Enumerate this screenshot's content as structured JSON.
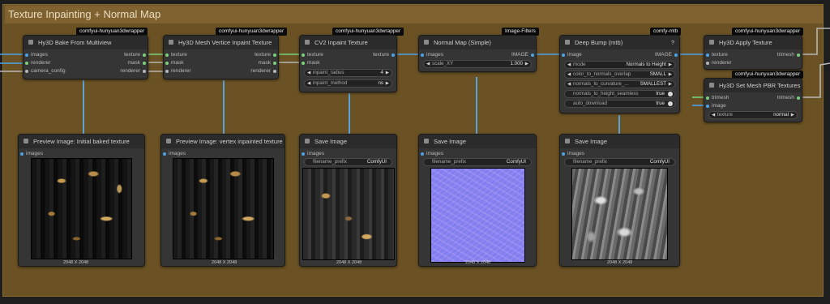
{
  "group": {
    "title": "Texture Inpainting + Normal Map"
  },
  "colors": {
    "group_bg": "#6b5224",
    "node_bg": "#353535",
    "wire_blue": "#5aa2d8",
    "slot_green": "#79d27a",
    "slot_blue": "#4da3e8",
    "slot_gray": "#b6b6b6"
  },
  "nodes": {
    "bake": {
      "badge": "comfyui-hunyuan3dwrapper",
      "title": "Hy3D Bake From Multiview",
      "inputs": [
        "images",
        "renderer",
        "camera_config"
      ],
      "outputs": [
        "texture",
        "mask",
        "renderer"
      ]
    },
    "inpaint": {
      "badge": "comfyui-hunyuan3dwrapper",
      "title": "Hy3D Mesh Vertice Inpaint Texture",
      "inputs": [
        "texture",
        "mask",
        "renderer"
      ],
      "outputs": [
        "texture",
        "mask",
        "renderer"
      ]
    },
    "cv2": {
      "badge": "comfyui-hunyuan3dwrapper",
      "title": "CV2 Inpaint Texture",
      "inputs": [
        "texture",
        "mask"
      ],
      "outputs": [
        "texture"
      ],
      "widgets": [
        {
          "label": "inpaint_radius",
          "value": "4"
        },
        {
          "label": "inpaint_method",
          "value": "ns"
        }
      ]
    },
    "normal": {
      "badge": "Image-Filters",
      "title": "Normal Map (Simple)",
      "inputs": [
        "images"
      ],
      "outputs": [
        "IMAGE"
      ],
      "widgets": [
        {
          "label": "scale_XY",
          "value": "1.000"
        }
      ]
    },
    "deepbump": {
      "badge": "comfy-mtb",
      "title": "Deep Bump (mtb)",
      "help": "?",
      "inputs": [
        "image"
      ],
      "outputs": [
        "IMAGE"
      ],
      "widgets": [
        {
          "label": "mode",
          "value": "Normals to Height"
        },
        {
          "label": "color_to_normals_overlap",
          "value": "SMALL"
        },
        {
          "label": "normals_to_curvature_...",
          "value": "SMALLEST"
        },
        {
          "label": "normals_to_height_seamless",
          "value": "true"
        },
        {
          "label": "auto_download",
          "value": "true"
        }
      ]
    },
    "apply": {
      "badge": "comfyui-hunyuan3dwrapper",
      "title": "Hy3D Apply Texture",
      "inputs": [
        "texture",
        "renderer"
      ],
      "outputs": [
        "trimesh"
      ]
    },
    "pbr": {
      "badge": "comfyui-hunyuan3dwrapper",
      "title": "Hy3D Set Mesh PBR Textures",
      "inputs": [
        "trimesh",
        "image"
      ],
      "outputs": [
        "trimesh"
      ],
      "widgets": [
        {
          "label": "texture",
          "value": "normal"
        }
      ]
    },
    "preview1": {
      "title": "Preview Image: Initial baked texture",
      "input": "images",
      "size": "2048 X 2048"
    },
    "preview2": {
      "title": "Preview Image: vertex inpainted texture",
      "input": "images",
      "size": "2048 X 2048"
    },
    "save1": {
      "title": "Save Image",
      "input": "images",
      "widget_label": "filename_prefix",
      "widget_value": "ComfyUI",
      "size": "2048 X 2048"
    },
    "save2": {
      "title": "Save Image",
      "input": "images",
      "widget_label": "filename_prefix",
      "widget_value": "ComfyUI",
      "size": "2048 X 2048"
    },
    "save3": {
      "title": "Save Image",
      "input": "images",
      "widget_label": "filename_prefix",
      "widget_value": "ComfyUI",
      "size": "2048 X 2048"
    }
  }
}
